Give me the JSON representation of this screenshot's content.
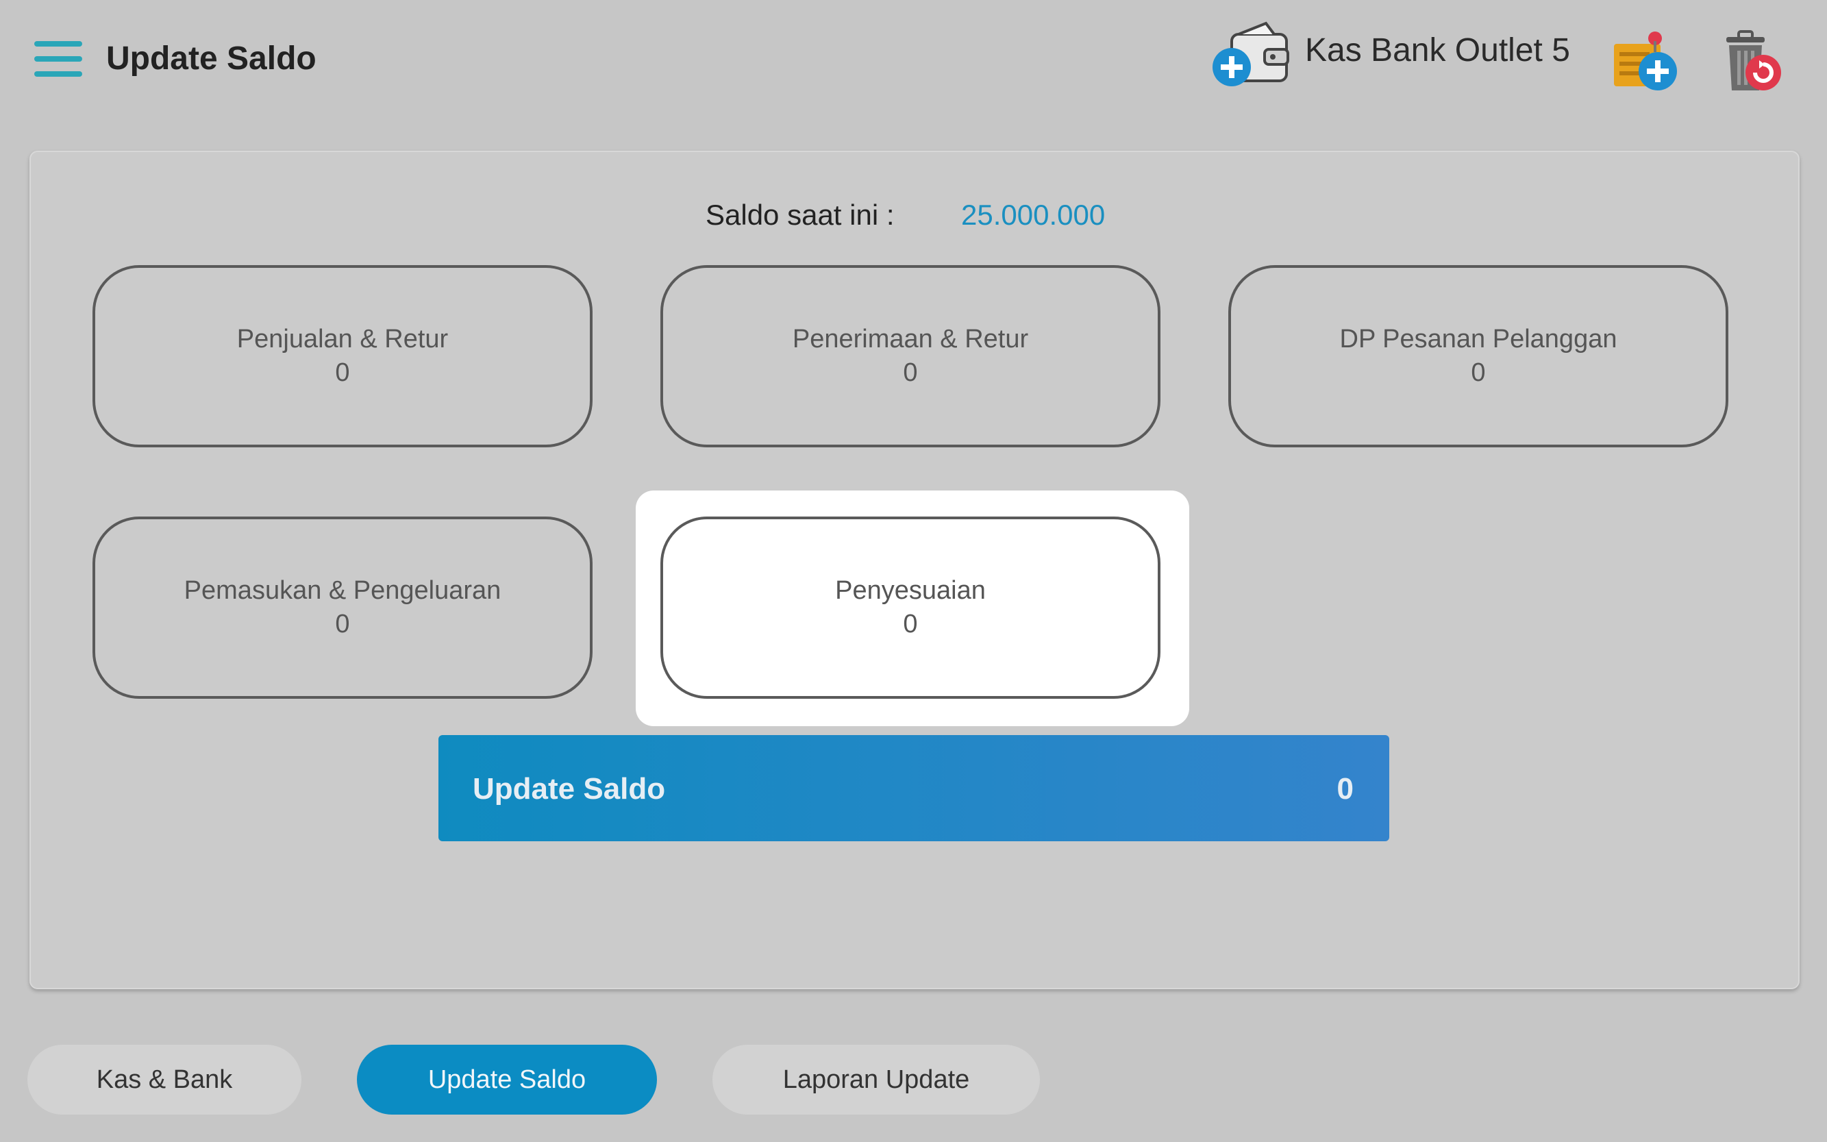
{
  "header": {
    "title": "Update Saldo",
    "outlet_name": "Kas Bank Outlet 5",
    "icons": [
      "menu-icon",
      "wallet-add-icon",
      "note-add-icon",
      "trash-restore-icon"
    ]
  },
  "balance": {
    "label": "Saldo saat ini :",
    "value": "25.000.000"
  },
  "categories": [
    {
      "label": "Penjualan & Retur",
      "value": "0"
    },
    {
      "label": "Penerimaan & Retur",
      "value": "0"
    },
    {
      "label": "DP Pesanan Pelanggan",
      "value": "0"
    },
    {
      "label": "Pemasukan & Pengeluaran",
      "value": "0"
    },
    {
      "label": "Penyesuaian",
      "value": "0"
    }
  ],
  "update_button": {
    "label": "Update Saldo",
    "value": "0"
  },
  "tabs": [
    {
      "label": "Kas & Bank"
    },
    {
      "label": "Update Saldo"
    },
    {
      "label": "Laporan Update"
    }
  ],
  "colors": {
    "accent": "#0b8cc3",
    "balance_value": "#1a8fc0",
    "background": "#c6c6c6"
  }
}
